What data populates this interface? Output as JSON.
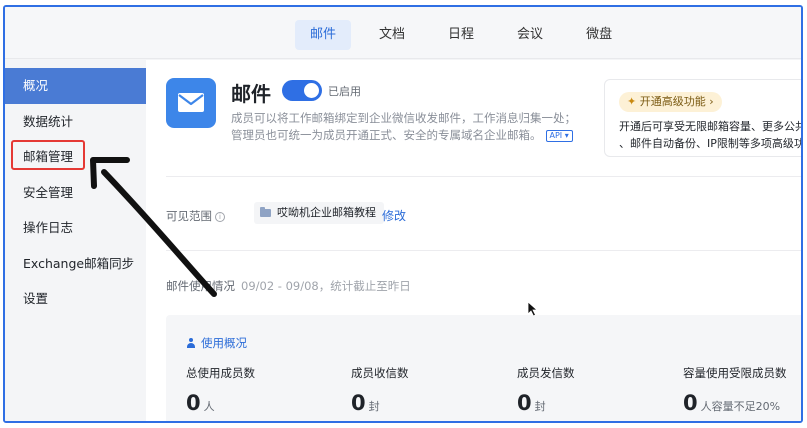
{
  "top_tabs": [
    {
      "label": "邮件",
      "active": true
    },
    {
      "label": "文档",
      "active": false
    },
    {
      "label": "日程",
      "active": false
    },
    {
      "label": "会议",
      "active": false
    },
    {
      "label": "微盘",
      "active": false
    }
  ],
  "sidebar": {
    "items": [
      {
        "label": "概况",
        "active": true
      },
      {
        "label": "数据统计",
        "active": false
      },
      {
        "label": "邮箱管理",
        "active": false,
        "highlighted": true
      },
      {
        "label": "安全管理",
        "active": false
      },
      {
        "label": "操作日志",
        "active": false
      },
      {
        "label": "Exchange邮箱同步",
        "active": false
      },
      {
        "label": "设置",
        "active": false
      }
    ]
  },
  "app": {
    "name": "邮件",
    "icon": "mail-envelope-icon",
    "enabled": true,
    "status_label": "已启用",
    "desc_line1": "成员可以将工作邮箱绑定到企业微信收发邮件，工作消息归集一处；",
    "desc_line2": "管理员也可统一为成员开通正式、安全的专属域名企业邮箱。",
    "api_tag": "API"
  },
  "upgrade": {
    "button_label": "开通高级功能",
    "line1": "开通后可享受无限邮箱容量、更多公共",
    "line2": "、邮件自动备份、IP限制等多项高级功"
  },
  "scope": {
    "label": "可见范围",
    "value": "哎呦机企业邮箱教程",
    "edit_label": "修改"
  },
  "usage": {
    "title": "邮件使用情况",
    "subtitle": "09/02 - 09/08，统计截止至昨日",
    "section_label": "使用概况",
    "stats": [
      {
        "label": "总使用成员数",
        "value": "0",
        "unit": "人"
      },
      {
        "label": "成员收信数",
        "value": "0",
        "unit": "封"
      },
      {
        "label": "成员发信数",
        "value": "0",
        "unit": "封"
      },
      {
        "label": "容量使用受限成员数",
        "value": "0",
        "unit": "人容量不足20%"
      }
    ]
  },
  "colors": {
    "accent": "#2f6fe4",
    "sidebar_active": "#4a7bd4",
    "highlight_red": "#e53935",
    "annotation_arrow": "#111111"
  }
}
